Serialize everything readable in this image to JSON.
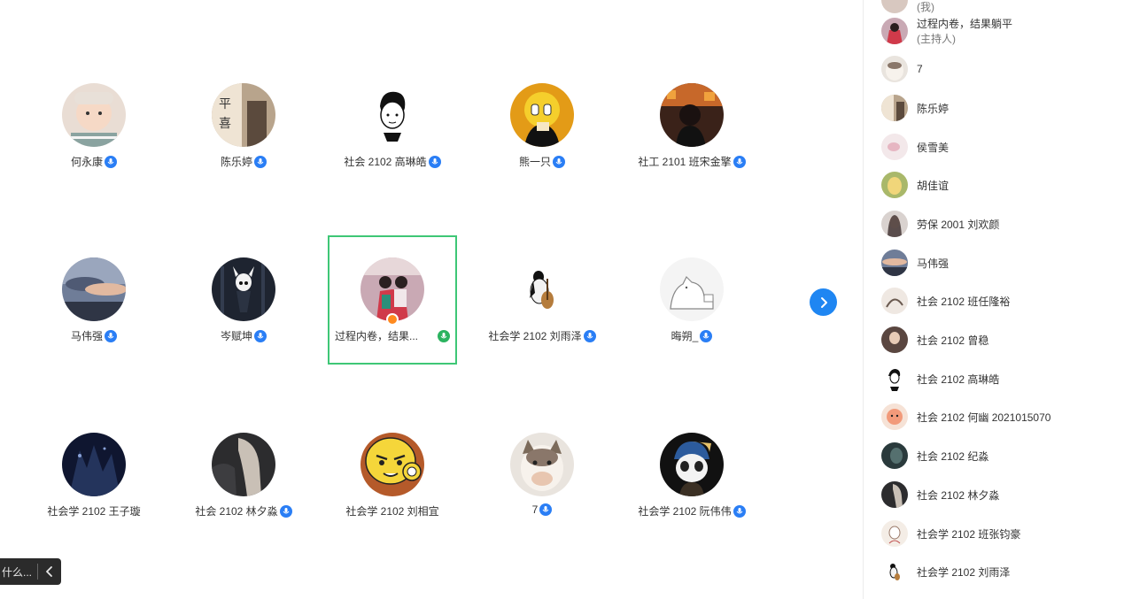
{
  "grid": {
    "row1": [
      {
        "name": "何永康"
      },
      {
        "name": "陈乐婷"
      },
      {
        "name": "社会 2102 高琳皓"
      },
      {
        "name": "熊一只"
      },
      {
        "name": "社工 2101 班宋金擎"
      }
    ],
    "row2": [
      {
        "name": "马伟强"
      },
      {
        "name": "岑赋坤"
      },
      {
        "name": "过程内卷，结果..."
      },
      {
        "name": "社会学 2102 刘雨泽"
      },
      {
        "name": "晦朔_"
      }
    ],
    "row3": [
      {
        "name": "社会学 2102 王子璇"
      },
      {
        "name": "社会 2102 林夕淼"
      },
      {
        "name": "社会学 2102 刘相宜"
      },
      {
        "name": "7"
      },
      {
        "name": "社会学 2102 阮伟伟"
      }
    ]
  },
  "chat_tip": {
    "text": "什么..."
  },
  "sidebar": {
    "top_partial": "(我)",
    "participants": [
      {
        "name": "过程内卷，结果躺平",
        "role": "(主持人)"
      },
      {
        "name": "7"
      },
      {
        "name": "陈乐婷"
      },
      {
        "name": "侯雪美"
      },
      {
        "name": "胡佳谊"
      },
      {
        "name": "劳保 2001 刘欢颜"
      },
      {
        "name": "马伟强"
      },
      {
        "name": "社会 2102 班任隆裕"
      },
      {
        "name": "社会 2102 曾稳"
      },
      {
        "name": "社会 2102 高琳皓"
      },
      {
        "name": "社会 2102 何幽 2021015070"
      },
      {
        "name": "社会 2102 纪淼"
      },
      {
        "name": "社会 2102 林夕淼"
      },
      {
        "name": "社会学 2102 班张钧豪"
      },
      {
        "name": "社会学 2102 刘雨泽"
      }
    ]
  },
  "colors": {
    "accent": "#1f86f2",
    "badge": "#2a7ef5",
    "selected_border": "#3ec776",
    "host": "#ff8a1f"
  }
}
